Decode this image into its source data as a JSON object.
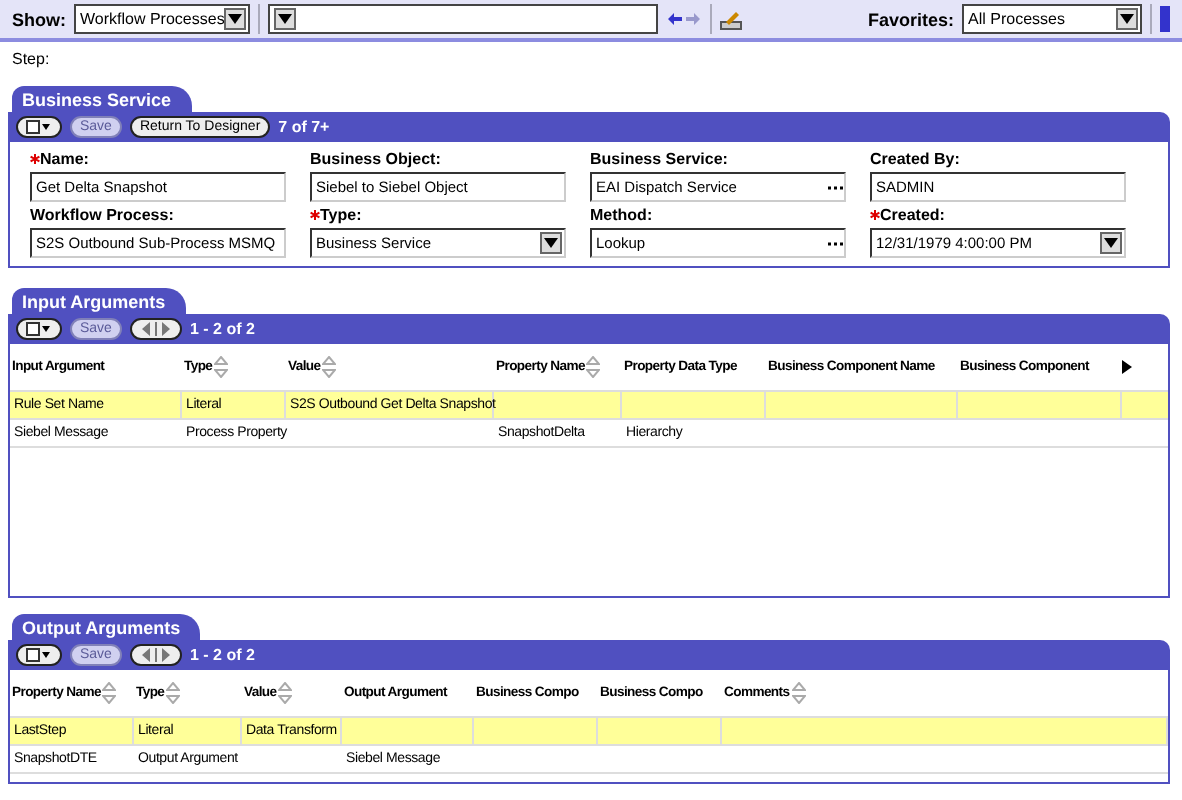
{
  "toolbar": {
    "show_label": "Show:",
    "show_value": "Workflow Processes",
    "favorites_label": "Favorites:",
    "favorites_value": "All Processes"
  },
  "step_label": "Step:",
  "business_service": {
    "title": "Business Service",
    "save": {
      "label": "Save",
      "disabled": true
    },
    "return_button": "Return To Designer",
    "count": "7 of 7+",
    "fields": [
      {
        "label": "Name:",
        "required": true,
        "value": "Get Delta Snapshot",
        "kind": "text"
      },
      {
        "label": "Business Object:",
        "required": false,
        "value": "Siebel to Siebel Object",
        "kind": "text"
      },
      {
        "label": "Business Service:",
        "required": false,
        "value": "EAI Dispatch Service",
        "kind": "picker"
      },
      {
        "label": "Created By:",
        "required": false,
        "value": "SADMIN",
        "kind": "text"
      },
      {
        "label": "Workflow Process:",
        "required": false,
        "value": "S2S Outbound Sub-Process MSMQ",
        "kind": "text"
      },
      {
        "label": "Type:",
        "required": true,
        "value": "Business Service",
        "kind": "dropdown"
      },
      {
        "label": "Method:",
        "required": false,
        "value": "Lookup",
        "kind": "picker"
      },
      {
        "label": "Created:",
        "required": true,
        "value": "12/31/1979 4:00:00 PM",
        "kind": "dropdown"
      }
    ]
  },
  "input_arguments": {
    "title": "Input Arguments",
    "save": {
      "label": "Save",
      "disabled": true
    },
    "count": "1 - 2 of 2",
    "more_columns": true,
    "columns": [
      {
        "label": "Input Argument",
        "sortable": false
      },
      {
        "label": "Type",
        "sortable": true
      },
      {
        "label": "Value",
        "sortable": true
      },
      {
        "label": "Property Name",
        "sortable": true
      },
      {
        "label": "Property Data Type",
        "sortable": false
      },
      {
        "label": "Business Component Name",
        "sortable": false
      },
      {
        "label": "Business Component",
        "sortable": false
      }
    ],
    "rows": [
      {
        "selected": true,
        "cells": [
          "Rule Set Name",
          "Literal",
          "S2S Outbound Get Delta Snapshot",
          "",
          "",
          "",
          ""
        ]
      },
      {
        "selected": false,
        "cells": [
          "Siebel Message",
          "Process Property",
          "",
          "SnapshotDelta",
          "Hierarchy",
          "",
          ""
        ]
      }
    ]
  },
  "output_arguments": {
    "title": "Output Arguments",
    "save": {
      "label": "Save",
      "disabled": true
    },
    "count": "1 - 2 of 2",
    "columns": [
      {
        "label": "Property Name",
        "sortable": true
      },
      {
        "label": "Type",
        "sortable": true
      },
      {
        "label": "Value",
        "sortable": true
      },
      {
        "label": "Output Argument",
        "sortable": false
      },
      {
        "label": "Business Compo",
        "sortable": false
      },
      {
        "label": "Business Compo",
        "sortable": false
      },
      {
        "label": "Comments",
        "sortable": true
      }
    ],
    "rows": [
      {
        "selected": true,
        "cells": [
          "LastStep",
          "Literal",
          "Data Transform",
          "",
          "",
          "",
          ""
        ]
      },
      {
        "selected": false,
        "cells": [
          "SnapshotDTE",
          "Output Argument",
          "",
          "Siebel Message",
          "",
          "",
          ""
        ]
      }
    ]
  }
}
